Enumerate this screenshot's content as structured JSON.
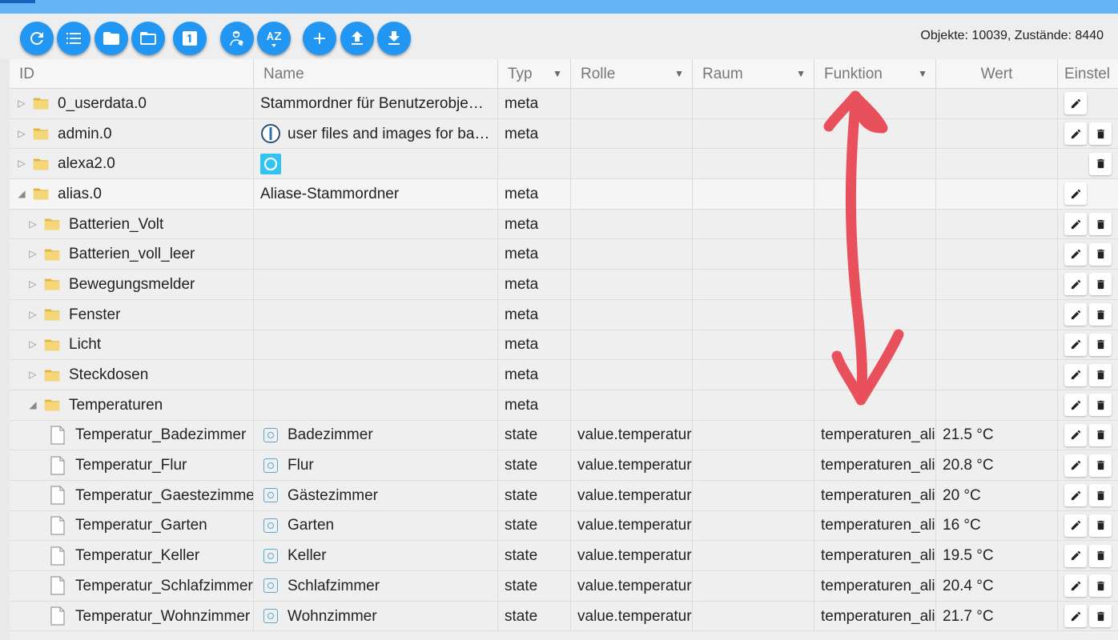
{
  "toolbar": {
    "buttons": [
      {
        "name": "refresh-icon"
      },
      {
        "name": "list-icon"
      },
      {
        "name": "folder-icon"
      },
      {
        "name": "folder-open-icon"
      },
      {
        "name": "one-box-icon",
        "label": "1"
      },
      {
        "name": "expert-mode-icon"
      },
      {
        "name": "sort-az-icon",
        "label": "AZ"
      },
      {
        "name": "add-icon"
      },
      {
        "name": "upload-icon"
      },
      {
        "name": "download-icon"
      }
    ],
    "counts": "Objekte: 10039, Zustände: 8440"
  },
  "columns": {
    "id": "ID",
    "name": "Name",
    "typ": "Typ",
    "rolle": "Rolle",
    "raum": "Raum",
    "funktion": "Funktion",
    "wert": "Wert",
    "einstellungen": "Einstel"
  },
  "rows": [
    {
      "id": "0_userdata.0",
      "name": "Stammordner für Benutzerobje…",
      "typ": "meta",
      "rolle": "",
      "funktion": "",
      "wert": ""
    },
    {
      "id": "admin.0",
      "name": "user files and images for ba…",
      "typ": "meta",
      "rolle": "",
      "funktion": "",
      "wert": ""
    },
    {
      "id": "alexa2.0",
      "name": "",
      "typ": "",
      "rolle": "",
      "funktion": "",
      "wert": ""
    },
    {
      "id": "alias.0",
      "name": "Aliase-Stammordner",
      "typ": "meta",
      "rolle": "",
      "funktion": "",
      "wert": ""
    },
    {
      "id": "Batterien_Volt",
      "name": "",
      "typ": "meta",
      "rolle": "",
      "funktion": "",
      "wert": ""
    },
    {
      "id": "Batterien_voll_leer",
      "name": "",
      "typ": "meta",
      "rolle": "",
      "funktion": "",
      "wert": ""
    },
    {
      "id": "Bewegungsmelder",
      "name": "",
      "typ": "meta",
      "rolle": "",
      "funktion": "",
      "wert": ""
    },
    {
      "id": "Fenster",
      "name": "",
      "typ": "meta",
      "rolle": "",
      "funktion": "",
      "wert": ""
    },
    {
      "id": "Licht",
      "name": "",
      "typ": "meta",
      "rolle": "",
      "funktion": "",
      "wert": ""
    },
    {
      "id": "Steckdosen",
      "name": "",
      "typ": "meta",
      "rolle": "",
      "funktion": "",
      "wert": ""
    },
    {
      "id": "Temperaturen",
      "name": "",
      "typ": "meta",
      "rolle": "",
      "funktion": "",
      "wert": ""
    },
    {
      "id": "Temperatur_Badezimmer",
      "name": "Badezimmer",
      "typ": "state",
      "rolle": "value.temperature",
      "funktion": "temperaturen_alias",
      "wert": "21.5 °C"
    },
    {
      "id": "Temperatur_Flur",
      "name": "Flur",
      "typ": "state",
      "rolle": "value.temperature",
      "funktion": "temperaturen_alias",
      "wert": "20.8 °C"
    },
    {
      "id": "Temperatur_Gaestezimmer",
      "name": "Gästezimmer",
      "typ": "state",
      "rolle": "value.temperature",
      "funktion": "temperaturen_alias",
      "wert": "20 °C"
    },
    {
      "id": "Temperatur_Garten",
      "name": "Garten",
      "typ": "state",
      "rolle": "value.temperature",
      "funktion": "temperaturen_alias",
      "wert": "16 °C"
    },
    {
      "id": "Temperatur_Keller",
      "name": "Keller",
      "typ": "state",
      "rolle": "value.temperature",
      "funktion": "temperaturen_alias",
      "wert": "19.5 °C"
    },
    {
      "id": "Temperatur_Schlafzimmer",
      "name": "Schlafzimmer",
      "typ": "state",
      "rolle": "value.temperature",
      "funktion": "temperaturen_alias",
      "wert": "20.4 °C"
    },
    {
      "id": "Temperatur_Wohnzimmer",
      "name": "Wohnzimmer",
      "typ": "state",
      "rolle": "value.temperature",
      "funktion": "temperaturen_alias",
      "wert": "21.7 °C"
    }
  ],
  "annotation": {
    "color": "#e8505b"
  }
}
